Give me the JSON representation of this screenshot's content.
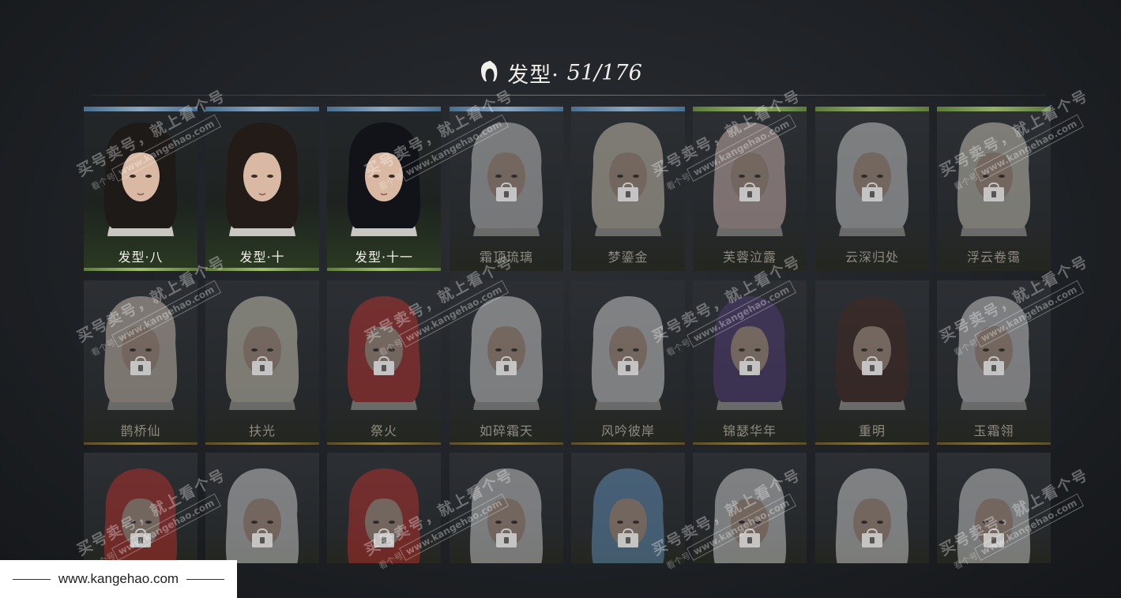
{
  "header": {
    "icon": "hairstyle-icon",
    "title": "发型·",
    "count": "51/176"
  },
  "cards": [
    {
      "name": "发型·八",
      "locked": false,
      "hair": "#1d1a18",
      "strip": "blue"
    },
    {
      "name": "发型·十",
      "locked": false,
      "hair": "#221b17",
      "strip": "blue"
    },
    {
      "name": "发型·十一",
      "locked": false,
      "hair": "#111318",
      "strip": "blue"
    },
    {
      "name": "霜顶琉璃",
      "locked": true,
      "hair": "#e6e6e6",
      "strip": "blue"
    },
    {
      "name": "梦鎏金",
      "locked": true,
      "hair": "#efe6cf",
      "strip": "blue"
    },
    {
      "name": "芙蓉泣露",
      "locked": true,
      "hair": "#f3d5cf",
      "strip": "green"
    },
    {
      "name": "云深归处",
      "locked": true,
      "hair": "#eeeeee",
      "strip": "green"
    },
    {
      "name": "浮云卷霭",
      "locked": true,
      "hair": "#f0ead8",
      "strip": "green"
    },
    {
      "name": "鹊桥仙",
      "locked": true,
      "hair": "#f1dfcf",
      "strip": ""
    },
    {
      "name": "扶光",
      "locked": true,
      "hair": "#f3ecd6",
      "strip": ""
    },
    {
      "name": "祭火",
      "locked": true,
      "hair": "#d8332e",
      "strip": ""
    },
    {
      "name": "如碎霜天",
      "locked": true,
      "hair": "#f2f2f2",
      "strip": ""
    },
    {
      "name": "风吟彼岸",
      "locked": true,
      "hair": "#f5f5f5",
      "strip": ""
    },
    {
      "name": "锦瑟华年",
      "locked": true,
      "hair": "#5b3f86",
      "strip": ""
    },
    {
      "name": "重明",
      "locked": true,
      "hair": "#4a2820",
      "strip": ""
    },
    {
      "name": "玉霜翎",
      "locked": true,
      "hair": "#f1eeef",
      "strip": ""
    },
    {
      "name": "",
      "locked": true,
      "hair": "#d8302c",
      "strip": ""
    },
    {
      "name": "",
      "locked": true,
      "hair": "#f2f2f2",
      "strip": ""
    },
    {
      "name": "",
      "locked": true,
      "hair": "#d8302c",
      "strip": ""
    },
    {
      "name": "",
      "locked": true,
      "hair": "#eeeeee",
      "strip": ""
    },
    {
      "name": "",
      "locked": true,
      "hair": "#6fa6d6",
      "strip": ""
    },
    {
      "name": "",
      "locked": true,
      "hair": "#f2f2f2",
      "strip": ""
    },
    {
      "name": "",
      "locked": true,
      "hair": "#f4f4f4",
      "strip": ""
    },
    {
      "name": "",
      "locked": true,
      "hair": "#eeeeee",
      "strip": ""
    }
  ],
  "watermark": {
    "big": "买号卖号，就上看个号",
    "url": "www.kangehao.com",
    "small": "看个号"
  },
  "footer": {
    "url": "www.kangehao.com"
  }
}
